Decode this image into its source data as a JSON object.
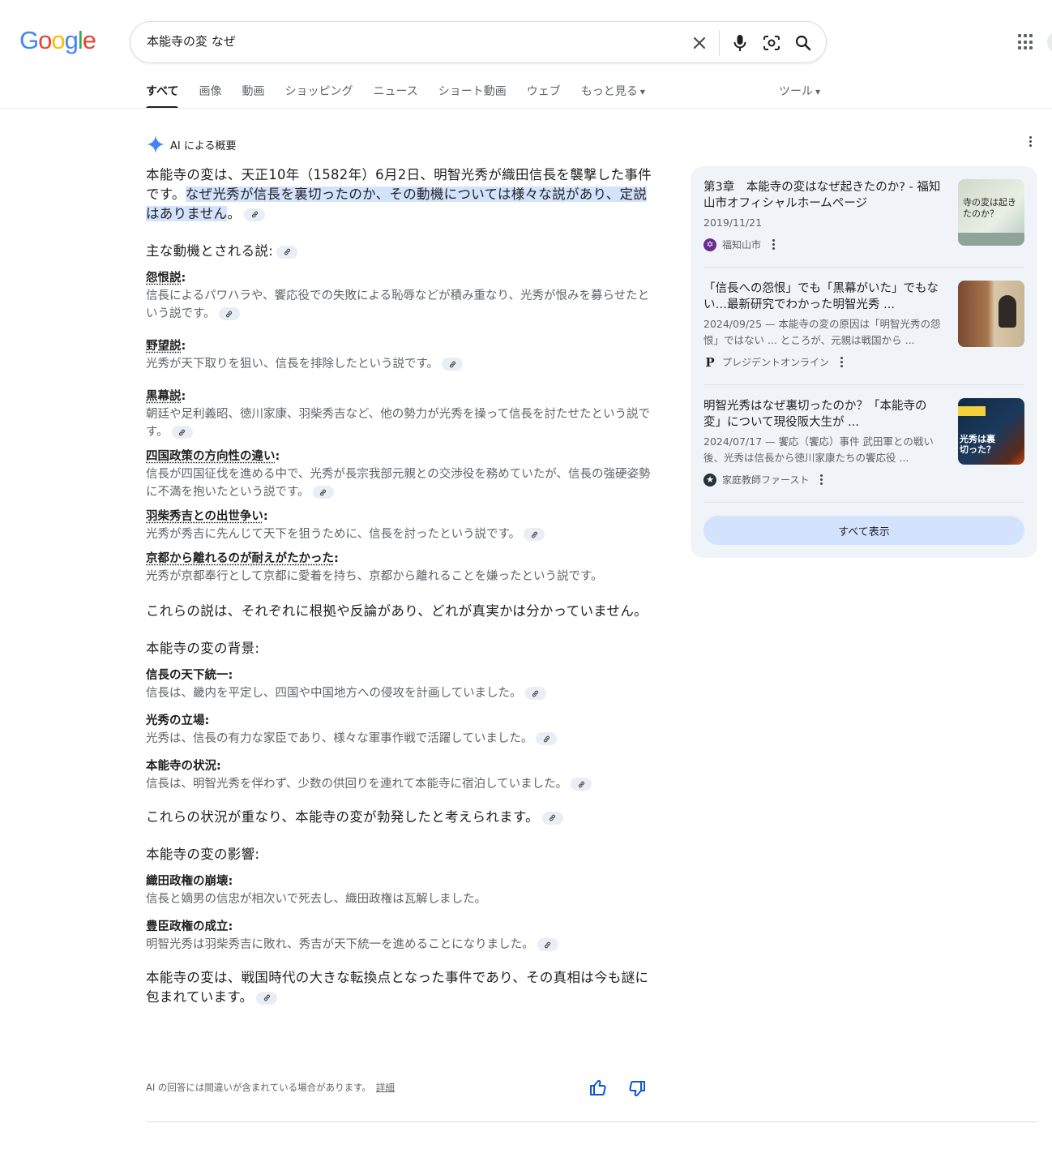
{
  "search": {
    "query": "本能寺の変 なぜ"
  },
  "tabs": [
    {
      "label": "すべて"
    },
    {
      "label": "画像"
    },
    {
      "label": "動画"
    },
    {
      "label": "ショッピング"
    },
    {
      "label": "ニュース"
    },
    {
      "label": "ショート動画"
    },
    {
      "label": "ウェブ"
    },
    {
      "label": "もっと見る"
    }
  ],
  "tools_label": "ツール",
  "ai_overview": {
    "title": "AI による概要",
    "lead_plain": "本能寺の変は、天正10年（1582年）6月2日、明智光秀が織田信長を襲撃した事件です。",
    "lead_highlight": "なぜ光秀が信長を裏切ったのか、その動機については様々な説があり、定説はありません",
    "lead_end": "。",
    "motives_heading": "主な動機とされる説:",
    "motives": [
      {
        "title": "怨恨説",
        "desc": "信長によるパワハラや、饗応役での失敗による恥辱などが積み重なり、光秀が恨みを募らせたという説です。"
      },
      {
        "title": "野望説",
        "desc": "光秀が天下取りを狙い、信長を排除したという説です。"
      },
      {
        "title": "黒幕説",
        "desc": "朝廷や足利義昭、徳川家康、羽柴秀吉など、他の勢力が光秀を操って信長を討たせたという説です。"
      },
      {
        "title": "四国政策の方向性の違い",
        "desc": "信長が四国征伐を進める中で、光秀が長宗我部元親との交渉役を務めていたが、信長の強硬姿勢に不満を抱いたという説です。"
      },
      {
        "title": "羽柴秀吉との出世争い",
        "desc": "光秀が秀吉に先んじて天下を狙うために、信長を討ったという説です。"
      },
      {
        "title": "京都から離れるのが耐えがたかった",
        "desc": "光秀が京都奉行として京都に愛着を持ち、京都から離れることを嫌ったという説です。"
      }
    ],
    "motives_summary": "これらの説は、それぞれに根拠や反論があり、どれが真実かは分かっていません。",
    "background_heading": "本能寺の変の背景:",
    "background": [
      {
        "title": "信長の天下統一",
        "desc": "信長は、畿内を平定し、四国や中国地方への侵攻を計画していました。"
      },
      {
        "title": "光秀の立場",
        "desc": "光秀は、信長の有力な家臣であり、様々な軍事作戦で活躍していました。"
      },
      {
        "title": "本能寺の状況",
        "desc": "信長は、明智光秀を伴わず、少数の供回りを連れて本能寺に宿泊していました。"
      }
    ],
    "background_summary": "これらの状況が重なり、本能寺の変が勃発したと考えられます。",
    "impact_heading": "本能寺の変の影響:",
    "impact": [
      {
        "title": "織田政権の崩壊",
        "desc": "信長と嫡男の信忠が相次いで死去し、織田政権は瓦解しました。"
      },
      {
        "title": "豊臣政権の成立",
        "desc": "明智光秀は羽柴秀吉に敗れ、秀吉が天下統一を進めることになりました。"
      }
    ],
    "conclusion": "本能寺の変は、戦国時代の大きな転換点となった事件であり、その真相は今も謎に包まれています。",
    "disclaimer": "AI の回答には間違いが含まれている場合があります。",
    "disclaimer_link": "詳細"
  },
  "sources": [
    {
      "title": "第3章　本能寺の変はなぜ起きたのか? - 福知山市オフィシャルホームページ",
      "date": "2019/11/21",
      "snippet": "",
      "site": "福知山市",
      "thumb_text": "寺の変は起きたのか？"
    },
    {
      "title": "「信長への怨恨」でも「黒幕がいた」でもない…最新研究でわかった明智光秀 ...",
      "date": "2024/09/25",
      "snippet": "2024/09/25 — 本能寺の変の原因は「明智光秀の怨恨」ではない ... ところが、元親は戦国から ...",
      "site": "プレジデントオンライン",
      "thumb_text": ""
    },
    {
      "title": "明智光秀はなぜ裏切ったのか？「本能寺の変」について現役阪大生が ...",
      "date": "2024/07/17",
      "snippet": "2024/07/17 — 饗応（饗応）事件 武田軍との戦い後、光秀は信長から徳川家康たちの饗応役 ...",
      "site": "家庭教師ファースト",
      "thumb_text": "光秀は裏切った？"
    }
  ],
  "show_all": "すべて表示",
  "colors": {
    "highlight": "#d3e3fd",
    "panel_bg": "#f0f4f9",
    "chip_bg": "#e9eef6",
    "ai_star": "#4285f4"
  }
}
